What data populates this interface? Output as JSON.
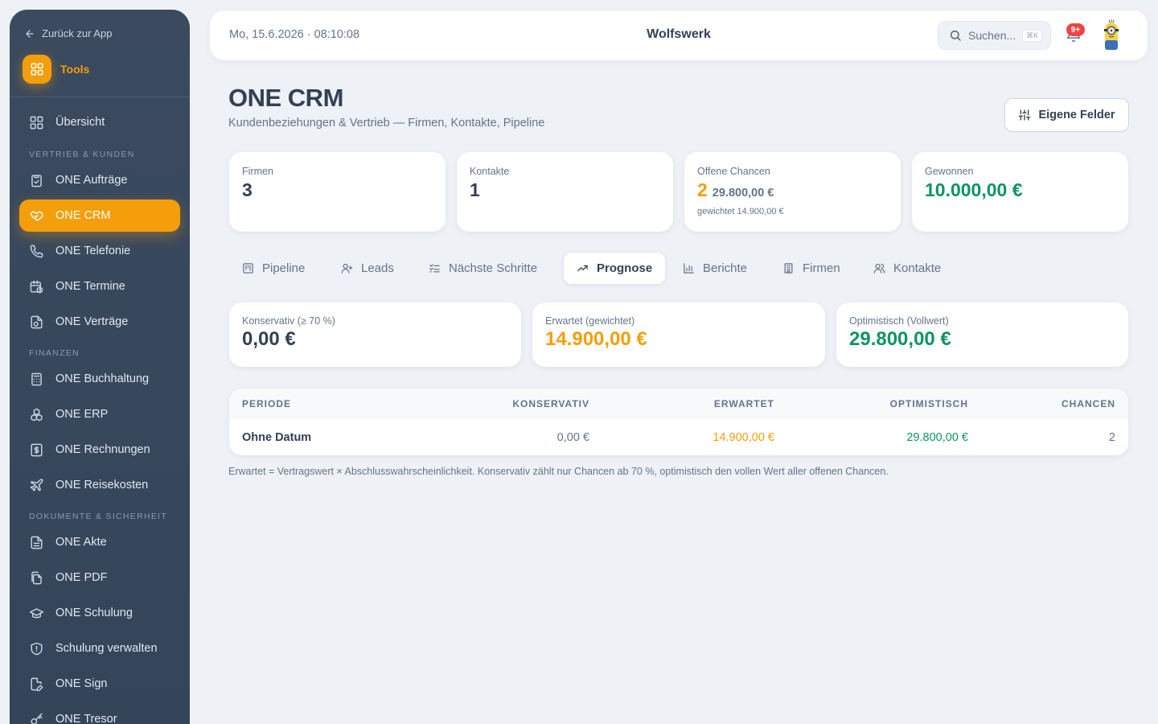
{
  "sidebar": {
    "back_label": "Zurück zur App",
    "tools_label": "Tools",
    "overview_label": "Übersicht",
    "sections": {
      "sales": "VERTRIEB & KUNDEN",
      "finance": "FINANZEN",
      "docs": "DOKUMENTE & SICHERHEIT"
    },
    "items": {
      "auftraege": "ONE Aufträge",
      "crm": "ONE CRM",
      "telefonie": "ONE Telefonie",
      "termine": "ONE Termine",
      "vertraege": "ONE Verträge",
      "buchhaltung": "ONE Buchhaltung",
      "erp": "ONE ERP",
      "rechnungen": "ONE Rechnungen",
      "reisekosten": "ONE Reisekosten",
      "akte": "ONE Akte",
      "pdf": "ONE PDF",
      "schulung": "ONE Schulung",
      "schulung_verwalten": "Schulung verwalten",
      "sign": "ONE Sign",
      "tresor": "ONE Tresor"
    },
    "active_item": "ONE CRM",
    "accent_color": "#f59e0b"
  },
  "header": {
    "datetime": "Mo, 15.6.2026 · 08:10:08",
    "brand": "Wolfswerk",
    "search_placeholder": "Suchen...",
    "search_shortcut": "⌘K",
    "notification_badge": "9+"
  },
  "page": {
    "title": "ONE CRM",
    "subtitle": "Kundenbeziehungen & Vertrieb — Firmen, Kontakte, Pipeline",
    "custom_fields_button": "Eigene Felder"
  },
  "kpis": {
    "firmen": {
      "label": "Firmen",
      "value": "3"
    },
    "kontakte": {
      "label": "Kontakte",
      "value": "1"
    },
    "chancen": {
      "label": "Offene Chancen",
      "value": "2",
      "amount": "29.800,00 €",
      "note": "gewichtet 14.900,00 €"
    },
    "gewonnen": {
      "label": "Gewonnen",
      "value": "10.000,00 €"
    }
  },
  "tabs": {
    "pipeline": "Pipeline",
    "leads": "Leads",
    "next_steps": "Nächste Schritte",
    "prognose": "Prognose",
    "berichte": "Berichte",
    "firmen": "Firmen",
    "kontakte": "Kontakte"
  },
  "active_tab": "Prognose",
  "forecast": {
    "konservativ": {
      "label": "Konservativ (≥ 70 %)",
      "value": "0,00 €"
    },
    "erwartet": {
      "label": "Erwartet (gewichtet)",
      "value": "14.900,00 €"
    },
    "optimistisch": {
      "label": "Optimistisch (Vollwert)",
      "value": "29.800,00 €"
    }
  },
  "table": {
    "headers": {
      "periode": "PERIODE",
      "konservativ": "KONSERVATIV",
      "erwartet": "ERWARTET",
      "optimistisch": "OPTIMISTISCH",
      "chancen": "CHANCEN"
    },
    "rows": [
      {
        "periode": "Ohne Datum",
        "konservativ": "0,00 €",
        "erwartet": "14.900,00 €",
        "optimistisch": "29.800,00 €",
        "chancen": "2"
      }
    ]
  },
  "footnote": "Erwartet = Vertragswert × Abschlusswahrscheinlichkeit. Konservativ zählt nur Chancen ab 70 %, optimistisch den vollen Wert aller offenen Chancen.",
  "colors": {
    "orange": "#f59e0b",
    "green": "#0e9462",
    "sidebar_bg": "#3b4a5e",
    "badge_red": "#ef4444"
  }
}
